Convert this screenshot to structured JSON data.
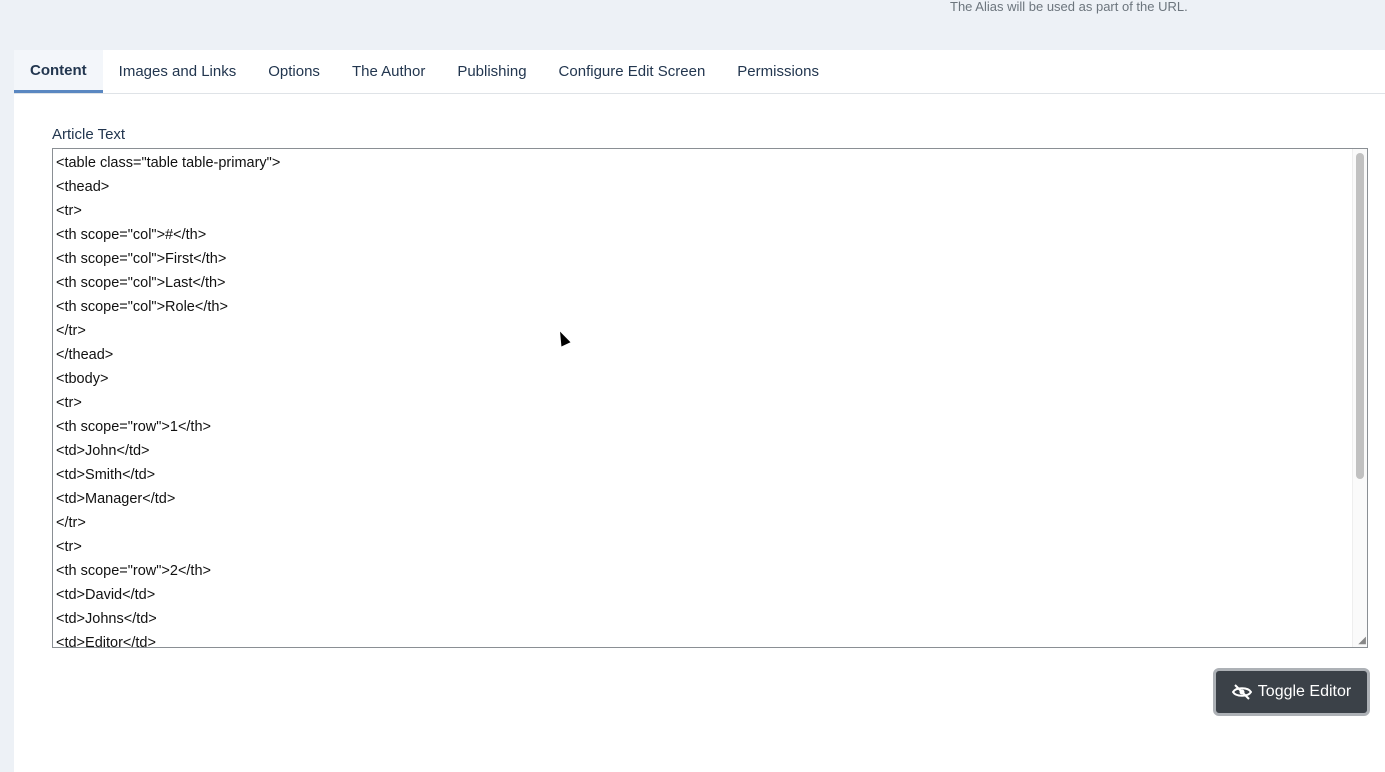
{
  "alias_hint": "The Alias will be used as part of the URL.",
  "tabs": [
    {
      "label": "Content",
      "active": true
    },
    {
      "label": "Images and Links"
    },
    {
      "label": "Options"
    },
    {
      "label": "The Author"
    },
    {
      "label": "Publishing"
    },
    {
      "label": "Configure Edit Screen"
    },
    {
      "label": "Permissions"
    }
  ],
  "article_text_label": "Article Text",
  "article_text": "<table class=\"table table-primary\">\n<thead>\n<tr>\n<th scope=\"col\">#</th>\n<th scope=\"col\">First</th>\n<th scope=\"col\">Last</th>\n<th scope=\"col\">Role</th>\n</tr>\n</thead>\n<tbody>\n<tr>\n<th scope=\"row\">1</th>\n<td>John</td>\n<td>Smith</td>\n<td>Manager</td>\n</tr>\n<tr>\n<th scope=\"row\">2</th>\n<td>David</td>\n<td>Johns</td>\n<td>Editor</td>",
  "toggle_editor_label": "Toggle Editor"
}
